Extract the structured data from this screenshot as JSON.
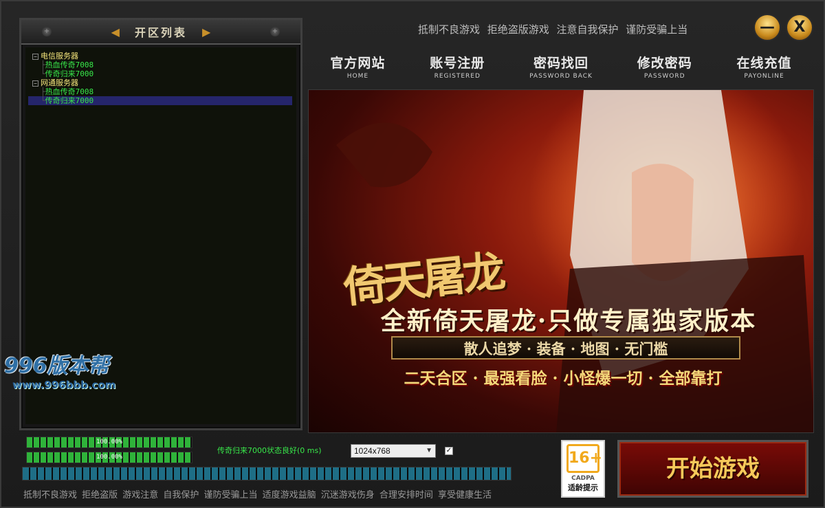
{
  "left_panel": {
    "title": "开区列表",
    "servers": [
      {
        "group": "电信服务器",
        "items": [
          "热血传奇7008",
          "传奇归来7000"
        ]
      },
      {
        "group": "网通服务器",
        "items": [
          "热血传奇7008",
          "传奇归来7000"
        ]
      }
    ],
    "selected": "网通服务器/传奇归来7000"
  },
  "notice": "抵制不良游戏  拒绝盗版游戏  注意自我保护  谨防受骗上当",
  "window_buttons": {
    "minimize": "—",
    "close": "X"
  },
  "nav": [
    {
      "cn": "官方网站",
      "en": "HOME"
    },
    {
      "cn": "账号注册",
      "en": "REGISTERED"
    },
    {
      "cn": "密码找回",
      "en": "PASSWORD BACK"
    },
    {
      "cn": "修改密码",
      "en": "PASSWORD"
    },
    {
      "cn": "在线充值",
      "en": "PAYONLINE"
    }
  ],
  "banner": {
    "logo": "倚天屠龙",
    "slogan": "全新倚天屠龙·只做专属独家版本",
    "sub_slogan": "散人追梦 · 装备 · 地图 · 无门槛",
    "sub_slogan2": "二天合区 · 最强看脸 · 小怪爆一切 · 全部靠打"
  },
  "watermark": {
    "main": "996版本帮",
    "sub": "www.996bbb.com"
  },
  "progress": [
    {
      "label": "100.00%",
      "value": 1.0
    },
    {
      "label": "100.00%",
      "value": 1.0
    }
  ],
  "status": "传奇归来7000状态良好(0 ms)",
  "resolution": {
    "value": "1024x768"
  },
  "checkbox_checked": true,
  "ticker": "抵制不良游戏  拒绝盗版  游戏注意  自我保护  谨防受骗上当  适度游戏益脑  沉迷游戏伤身  合理安排时间  享受健康生活",
  "age_rating": {
    "num": "16+",
    "org": "CADPA",
    "tip": "适龄提示"
  },
  "start_button": "开始游戏",
  "colors": {
    "accent_green": "#38e84a",
    "selected_bg": "#25256b",
    "gold": "#f5c95a"
  }
}
